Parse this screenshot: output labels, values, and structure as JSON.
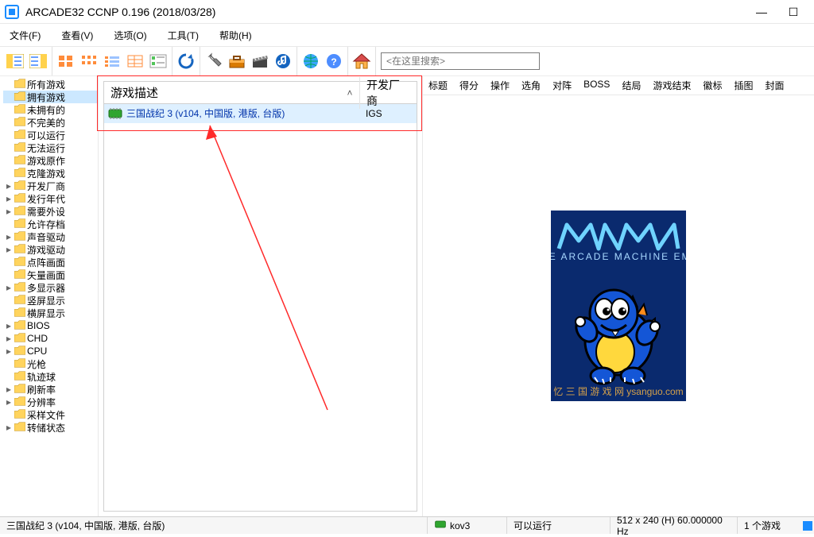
{
  "title": "ARCADE32 CCNP 0.196 (2018/03/28)",
  "menu": [
    "文件(F)",
    "查看(V)",
    "选项(O)",
    "工具(T)",
    "帮助(H)"
  ],
  "search_placeholder": "<在这里搜索>",
  "tree": [
    {
      "label": "所有游戏",
      "icon": "folder-blue"
    },
    {
      "label": "拥有游戏",
      "icon": "folder",
      "selected": true
    },
    {
      "label": "未拥有的",
      "icon": "folder"
    },
    {
      "label": "不完美的",
      "icon": "folder-no"
    },
    {
      "label": "可以运行",
      "icon": "folder"
    },
    {
      "label": "无法运行",
      "icon": "folder-warn"
    },
    {
      "label": "游戏原作",
      "icon": "folder-p"
    },
    {
      "label": "克隆游戏",
      "icon": "folder"
    },
    {
      "label": "开发厂商",
      "icon": "folder",
      "expand": true
    },
    {
      "label": "发行年代",
      "icon": "folder-clock",
      "expand": true
    },
    {
      "label": "需要外设",
      "icon": "folder-list",
      "expand": true
    },
    {
      "label": "允许存档",
      "icon": "folder-check"
    },
    {
      "label": "声音驱动",
      "icon": "folder",
      "expand": true
    },
    {
      "label": "游戏驱动",
      "icon": "folder",
      "expand": true
    },
    {
      "label": "点阵画面",
      "icon": "folder-dot"
    },
    {
      "label": "矢量画面",
      "icon": "folder-vec"
    },
    {
      "label": "多显示器",
      "icon": "folder",
      "expand": true
    },
    {
      "label": "竖屏显示",
      "icon": "folder-vert"
    },
    {
      "label": "横屏显示",
      "icon": "folder-horiz"
    },
    {
      "label": "BIOS",
      "icon": "folder-gear",
      "expand": true
    },
    {
      "label": "CHD",
      "icon": "folder-disc",
      "expand": true
    },
    {
      "label": "CPU",
      "icon": "folder-cpu",
      "expand": true
    },
    {
      "label": "光枪",
      "icon": "folder-gun"
    },
    {
      "label": "轨迹球",
      "icon": "folder-ball"
    },
    {
      "label": "刷新率",
      "icon": "folder-hz",
      "expand": true
    },
    {
      "label": "分辨率",
      "icon": "folder-res",
      "expand": true
    },
    {
      "label": "采样文件",
      "icon": "folder-sample"
    },
    {
      "label": "转储状态",
      "icon": "folder-dump",
      "expand": true
    }
  ],
  "list": {
    "headers": {
      "desc": "游戏描述",
      "dev": "开发厂商"
    },
    "rows": [
      {
        "desc": "三国战纪 3 (v104, 中国版, 港版, 台版)",
        "dev": "IGS"
      }
    ]
  },
  "tabs": [
    "标题",
    "得分",
    "操作",
    "选角",
    "对阵",
    "BOSS",
    "结局",
    "游戏结束",
    "徽标",
    "插图",
    "封面"
  ],
  "status": {
    "name": "三国战纪 3 (v104, 中国版, 港版, 台版)",
    "rom": "kov3",
    "run": "可以运行",
    "res": "512 x 240 (H) 60.000000 Hz",
    "count": "1 个游戏"
  }
}
